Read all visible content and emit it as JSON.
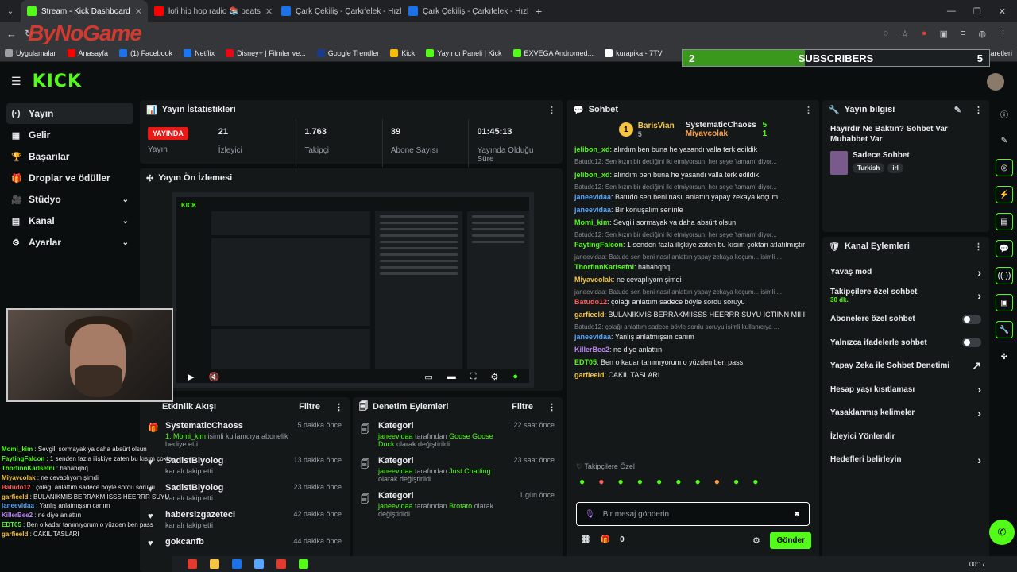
{
  "browser": {
    "tabs": [
      {
        "label": "Stream - Kick Dashboard",
        "color": "#53fc18"
      },
      {
        "label": "lofi hip hop radio 📚 beats",
        "color": "#ff0000"
      },
      {
        "label": "Çark Çekiliş - Çarkıfelek - Hızlı Ç",
        "color": "#1a73e8"
      },
      {
        "label": "Çark Çekiliş - Çarkıfelek - Hızlı Ç",
        "color": "#1a73e8"
      }
    ],
    "new_tab": "+",
    "watermark": "ByNoGame",
    "bookmarks": [
      "Uygulamalar",
      "Anasayfa",
      "(1) Facebook",
      "Netflix",
      "Disney+ | Filmler ve...",
      "Google Trendler",
      "Kick",
      "Yayıncı Paneli | Kick",
      "EXVEGA Andromed...",
      "kurapika - 7TV"
    ],
    "bookmark_folder": "Tüm Yer İşaretleri"
  },
  "subscriber_goal": {
    "current": "2",
    "label": "SUBSCRIBERS",
    "target": "5",
    "progress": 0.4
  },
  "app": {
    "logo": "KICK",
    "sidebar": [
      {
        "label": "Yayın",
        "icon": "(·)",
        "chev": ""
      },
      {
        "label": "Gelir",
        "icon": "▦",
        "chev": ""
      },
      {
        "label": "Başarılar",
        "icon": "🏆",
        "chev": ""
      },
      {
        "label": "Droplar ve ödüller",
        "icon": "🎁",
        "chev": ""
      },
      {
        "label": "Stüdyo",
        "icon": "🎥",
        "chev": "⌄"
      },
      {
        "label": "Kanal",
        "icon": "▤",
        "chev": "⌄"
      },
      {
        "label": "Ayarlar",
        "icon": "⚙",
        "chev": "⌄"
      }
    ],
    "stats": {
      "title": "Yayın İstatistikleri",
      "live": "YAYINDA",
      "live_label": "Yayın",
      "items": [
        {
          "value": "21",
          "label": "İzleyici"
        },
        {
          "value": "1.763",
          "label": "Takipçi"
        },
        {
          "value": "39",
          "label": "Abone Sayısı"
        },
        {
          "value": "01:45:13",
          "label": "Yayında Olduğu Süre"
        }
      ]
    },
    "preview": {
      "title": "Yayın Ön İzlemesi"
    },
    "activity": {
      "title": "Etkinlik Akışı",
      "filter": "Filtre",
      "items": [
        {
          "icon": "🎁",
          "title": "SystematicChaoss",
          "sub_highlight": "1. Momi_kim",
          "sub": " isimli kullanıcıya abonelik hediye etti.",
          "time": "5 dakika önce"
        },
        {
          "icon": "♥",
          "title": "SadistBiyolog",
          "sub_highlight": "",
          "sub": "kanalı takip etti",
          "time": "13 dakika önce"
        },
        {
          "icon": "♥",
          "title": "SadistBiyolog",
          "sub_highlight": "",
          "sub": "kanalı takip etti",
          "time": "23 dakika önce"
        },
        {
          "icon": "♥",
          "title": "habersizgazeteci",
          "sub_highlight": "",
          "sub": "kanalı takip etti",
          "time": "42 dakika önce"
        },
        {
          "icon": "♥",
          "title": "gokcanfb",
          "sub_highlight": "",
          "sub": "",
          "time": "44 dakika önce"
        }
      ]
    },
    "moderation": {
      "title": "Denetim Eylemleri",
      "filter": "Filtre",
      "items": [
        {
          "title": "Kategori",
          "user": "janeevidaa",
          "mid": " tarafından ",
          "target": "Goose Goose Duck",
          "end": " olarak değiştirildi",
          "time": "22 saat önce"
        },
        {
          "title": "Kategori",
          "user": "janeevidaa",
          "mid": " tarafından ",
          "target": "Just Chatting",
          "end": " olarak değiştirildi",
          "time": "23 saat önce"
        },
        {
          "title": "Kategori",
          "user": "janeevidaa",
          "mid": " tarafından ",
          "target": "Brotato",
          "end": " olarak değiştirildi",
          "time": "1 gün önce"
        }
      ]
    },
    "chat": {
      "title": "Sohbet",
      "leader": {
        "rank": "1",
        "name": "BarisVian",
        "count": "5"
      },
      "top": [
        {
          "name": "SystematicChaoss",
          "count": "5"
        },
        {
          "name": "Miyavcolak",
          "count": "1"
        }
      ],
      "messages": [
        {
          "reply": "",
          "user": "jelibon_xd",
          "cls": "u-g",
          "text": "alırdım ben buna he yasandı valla terk edildik"
        },
        {
          "reply": "Batudo12: Sen kızın bir dediğini iki etmiyorsun, her şeye 'tamam' diyor...",
          "user": "",
          "cls": "",
          "text": ""
        },
        {
          "reply": "",
          "user": "jelibon_xd",
          "cls": "u-g",
          "text": "alındım ben buna he yasandı valla terk edildik"
        },
        {
          "reply": "Batudo12: Sen kızın bir dediğini iki etmiyorsun, her şeye 'tamam' diyor...",
          "user": "janeevidaa",
          "cls": "u-b",
          "text": "Batudo sen beni nasıl anlattın yapay zekaya koçum..."
        },
        {
          "reply": "",
          "user": "janeevidaa",
          "cls": "u-b",
          "text": "Bir konuşalım seninle"
        },
        {
          "reply": "",
          "user": "Momi_kim",
          "cls": "u-g",
          "text": "Sevgili sormayak ya daha absürt olsun"
        },
        {
          "reply": "Batudo12: Sen kızın bir dediğini iki etmiyorsun, her şeye 'tamam' diyor...",
          "user": "FaytingFalcon",
          "cls": "u-g",
          "text": "1 senden fazla ilişkiye zaten bu kısım çoktan atlatılmıştır"
        },
        {
          "reply": "janeevidaa: Batudo sen beni nasıl anlattın yapay zekaya koçum... isimli ...",
          "user": "ThorfinnKarlsefni",
          "cls": "u-g",
          "text": "hahahqhq"
        },
        {
          "reply": "",
          "user": "Miyavcolak",
          "cls": "u-y",
          "text": "ne cevaplıyom şimdi"
        },
        {
          "reply": "janeevidaa: Batudo sen beni nasıl anlattın yapay zekaya koçum... isimli ...",
          "user": "Batudo12",
          "cls": "u-r",
          "text": "çolağı anlattım sadece böyle sordu soruyu"
        },
        {
          "reply": "",
          "user": "garfieeld",
          "cls": "u-y",
          "text": "BULANIKMIS BERRAKMIISSS HEERRR SUYU İCTİİNN Mİİİİİ"
        },
        {
          "reply": "Batudo12: çolağı anlattım sadece böyle sordu soruyu isimli kullanıcıya ...",
          "user": "janeevidaa",
          "cls": "u-b",
          "text": "Yanlış anlatmışsın canım"
        },
        {
          "reply": "",
          "user": "KillerBee2",
          "cls": "u-p",
          "text": "ne diye anlattın"
        },
        {
          "reply": "",
          "user": "EDT05",
          "cls": "u-g",
          "text": "Ben o kadar tanımıyorum o yüzden ben pass"
        },
        {
          "reply": "",
          "user": "garfieeld",
          "cls": "u-y",
          "text": "CAKIL TASLARI"
        }
      ],
      "followers_only": "Takipçilere Özel",
      "input_placeholder": "Bir mesaj gönderin",
      "count": "0",
      "send": "Gönder"
    },
    "stream_info": {
      "title": "Yayın bilgisi",
      "stream_title": "Hayırdır Ne Baktın? Sohbet Var Muhabbet Var",
      "category": "Sadece Sohbet",
      "tags": [
        "Turkish",
        "irl"
      ]
    },
    "channel_actions": {
      "title": "Kanal Eylemleri",
      "items": [
        {
          "label": "Yavaş mod",
          "sub": "",
          "ctrl": "›"
        },
        {
          "label": "Takipçilere özel sohbet",
          "sub": "30 dk.",
          "ctrl": "›"
        },
        {
          "label": "Abonelere özel sohbet",
          "sub": "",
          "ctrl": "toggle"
        },
        {
          "label": "Yalnızca ifadelerle sohbet",
          "sub": "",
          "ctrl": "toggle"
        },
        {
          "label": "Yapay Zeka ile Sohbet Denetimi",
          "sub": "",
          "ctrl": "↗"
        },
        {
          "label": "Hesap yaşı kısıtlaması",
          "sub": "",
          "ctrl": "›"
        },
        {
          "label": "Yasaklanmış kelimeler",
          "sub": "",
          "ctrl": "›"
        },
        {
          "label": "İzleyici Yönlendir",
          "sub": "",
          "ctrl": ""
        },
        {
          "label": "Hedefleri belirleyin",
          "sub": "",
          "ctrl": "›"
        }
      ]
    }
  },
  "overlay_chat": [
    {
      "user": "Momi_kim",
      "cls": "u-g",
      "text": "Sevgili sormayak ya daha absürt olsun"
    },
    {
      "user": "FaytingFalcon",
      "cls": "u-g",
      "text": "1 senden fazla ilişkiye zaten bu kısım çoktan atlatılmıştır"
    },
    {
      "user": "ThorfinnKarlsefni",
      "cls": "u-g",
      "text": "hahahqhq"
    },
    {
      "user": "Miyavcolak",
      "cls": "u-y",
      "text": "ne cevaplıyom şimdi"
    },
    {
      "user": "Batudo12",
      "cls": "u-r",
      "text": "çolağı anlattım sadece böyle sordu soruyu"
    },
    {
      "user": "garfieeld",
      "cls": "u-y",
      "text": "BULANIKMIS BERRAKMIISSS HEERRR SUYU İCTİİNN Mİİİİİ"
    },
    {
      "user": "janeevidaa",
      "cls": "u-b",
      "text": "Yanlış anlatmışsın canım"
    },
    {
      "user": "KillerBee2",
      "cls": "u-p",
      "text": "ne diye anlattın"
    },
    {
      "user": "EDT05",
      "cls": "u-g",
      "text": "Ben o kadar tanımıyorum o yüzden ben pass"
    },
    {
      "user": "garfieeld",
      "cls": "u-y",
      "text": "CAKIL TASLARI"
    }
  ],
  "clock": "00:17"
}
